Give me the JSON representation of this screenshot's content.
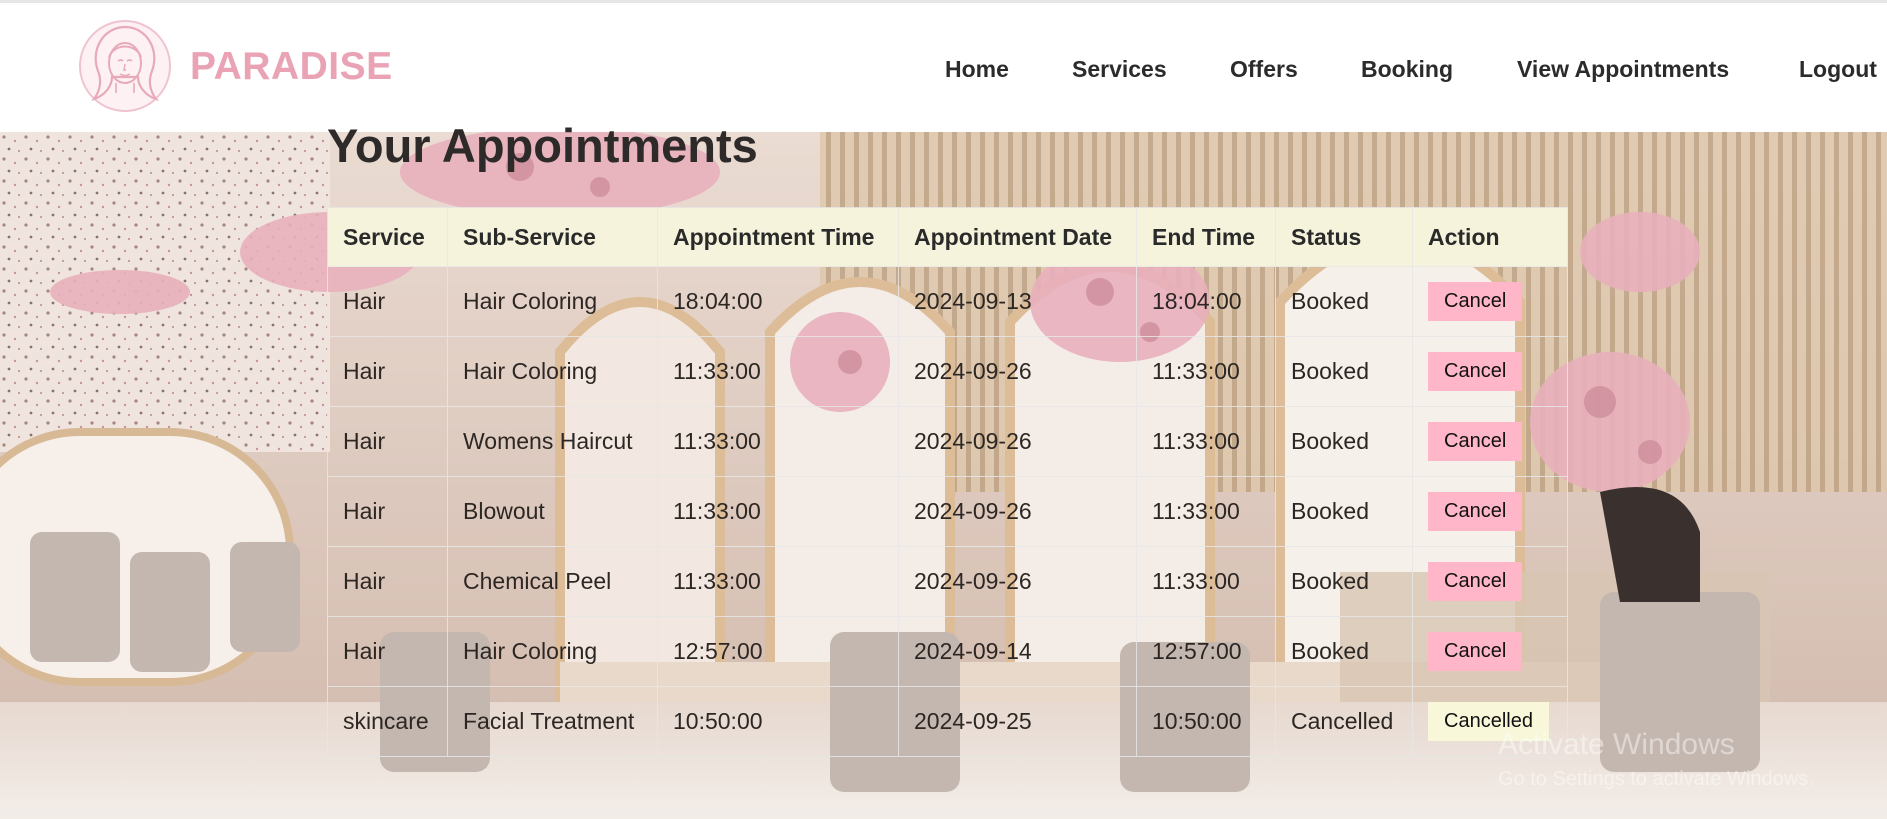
{
  "brand": {
    "name": "PARADISE",
    "logo": "woman-face-logo"
  },
  "nav": {
    "items": [
      {
        "label": "Home"
      },
      {
        "label": "Services"
      },
      {
        "label": "Offers"
      },
      {
        "label": "Booking"
      },
      {
        "label": "View Appointments"
      },
      {
        "label": "Logout"
      }
    ]
  },
  "page": {
    "title": "Your Appointments"
  },
  "table": {
    "headers": [
      "Service",
      "Sub-Service",
      "Appointment Time",
      "Appointment Date",
      "End Time",
      "Status",
      "Action"
    ],
    "rows": [
      {
        "service": "Hair",
        "sub_service": "Hair Coloring",
        "time": "18:04:00",
        "date": "2024-09-13",
        "end": "18:04:00",
        "status": "Booked",
        "action": "Cancel"
      },
      {
        "service": "Hair",
        "sub_service": "Hair Coloring",
        "time": "11:33:00",
        "date": "2024-09-26",
        "end": "11:33:00",
        "status": "Booked",
        "action": "Cancel"
      },
      {
        "service": "Hair",
        "sub_service": "Womens Haircut",
        "time": "11:33:00",
        "date": "2024-09-26",
        "end": "11:33:00",
        "status": "Booked",
        "action": "Cancel"
      },
      {
        "service": "Hair",
        "sub_service": "Blowout",
        "time": "11:33:00",
        "date": "2024-09-26",
        "end": "11:33:00",
        "status": "Booked",
        "action": "Cancel"
      },
      {
        "service": "Hair",
        "sub_service": "Chemical Peel",
        "time": "11:33:00",
        "date": "2024-09-26",
        "end": "11:33:00",
        "status": "Booked",
        "action": "Cancel"
      },
      {
        "service": "Hair",
        "sub_service": "Hair Coloring",
        "time": "12:57:00",
        "date": "2024-09-14",
        "end": "12:57:00",
        "status": "Booked",
        "action": "Cancel"
      },
      {
        "service": "skincare",
        "sub_service": "Facial Treatment",
        "time": "10:50:00",
        "date": "2024-09-25",
        "end": "10:50:00",
        "status": "Cancelled",
        "action": "Cancelled"
      }
    ]
  },
  "watermark": {
    "line1": "Activate Windows",
    "line2": "Go to Settings to activate Windows."
  },
  "colors": {
    "brand_pink": "#e9a3b5",
    "cancel_button": "#ffb6c8",
    "cancelled_button": "#f8f7da",
    "header_bg": "#f6f3dc"
  }
}
